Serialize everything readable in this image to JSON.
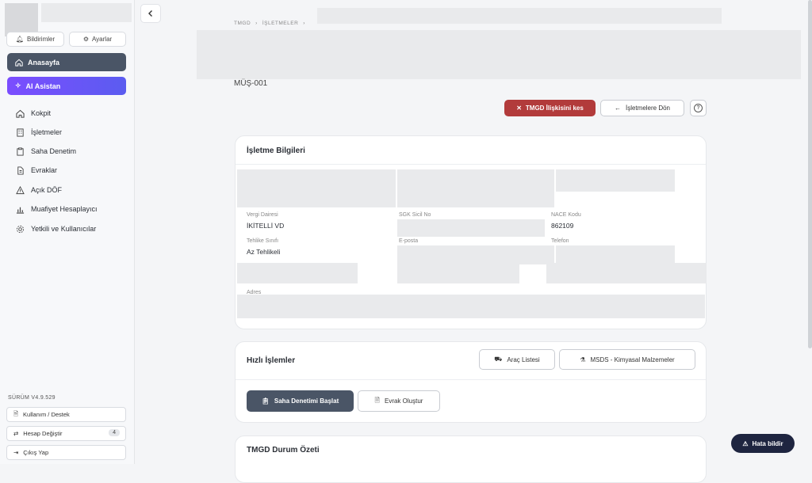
{
  "sidebar": {
    "top_buttons": {
      "left": "Bildirimler",
      "right": "Ayarlar"
    },
    "home": "Anasayfa",
    "ai": "AI Asistan",
    "items": [
      {
        "label": "Kokpit",
        "icon": "home-icon"
      },
      {
        "label": "İşletmeler",
        "icon": "building-icon"
      },
      {
        "label": "Saha Denetim",
        "icon": "clipboard-icon"
      },
      {
        "label": "Evraklar",
        "icon": "document-icon"
      },
      {
        "label": "Açık DÖF",
        "icon": "warning-icon"
      },
      {
        "label": "Muafiyet Hesaplayıcı",
        "icon": "chart-icon"
      },
      {
        "label": "Yetkili ve Kullanıcılar",
        "icon": "users-icon"
      }
    ],
    "version": "SÜRÜM V4.9.529",
    "footer": {
      "support": "Kullanım / Destek",
      "switch_account": "Hesap Değiştir",
      "switch_count": "4",
      "logout": "Çıkış Yap"
    }
  },
  "breadcrumb": {
    "root": "TMGD",
    "section": "İŞLETMELER"
  },
  "customer_code": "MÜŞ-001",
  "actions": {
    "remove_relation": "TMGD İlişkisini kes",
    "back_to_list": "İşletmelere Dön"
  },
  "info": {
    "title": "İşletme Bilgileri",
    "tax_office_label": "Vergi Dairesi",
    "tax_office": "İKİTELLİ VD",
    "sgk_label": "SGK Sicil No",
    "nace_label": "NACE Kodu",
    "nace": "862109",
    "hazard_label": "Tehlike Sınıfı",
    "hazard": "Az Tehlikeli",
    "email_label": "E-posta",
    "phone_label": "Telefon",
    "address_label": "Adres"
  },
  "quick": {
    "title": "Hızlı İşlemler",
    "vehicles": "Araç Listesi",
    "msds": "MSDS - Kimyasal Malzemeler",
    "start_inspection": "Saha Denetimi Başlat",
    "create_doc": "Evrak Oluştur"
  },
  "status": {
    "title": "TMGD Durum Özeti"
  },
  "report_bug": "Hata bildir",
  "colors": {
    "primary_dark": "#4a5566",
    "ai_purple": "#7b4dff",
    "danger": "#b23b3b",
    "report": "#1e2540"
  }
}
